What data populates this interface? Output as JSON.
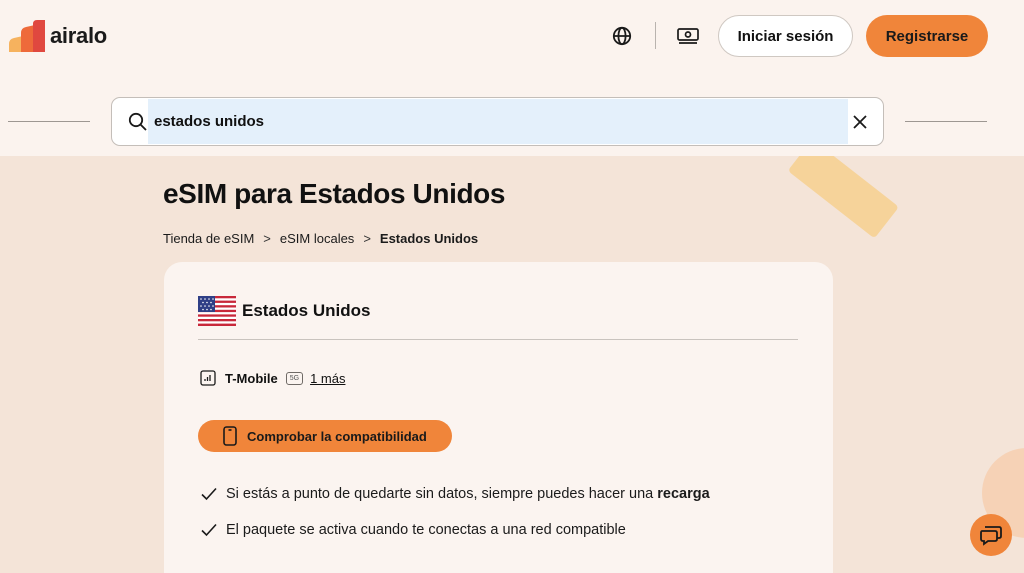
{
  "header": {
    "logo_text": "airalo",
    "login_label": "Iniciar sesión",
    "register_label": "Registrarse",
    "icons": [
      "globe-icon",
      "currency-icon"
    ]
  },
  "search": {
    "value": "estados unidos",
    "icon": "search-icon",
    "clear_icon": "close-icon"
  },
  "main": {
    "title": "eSIM para Estados Unidos",
    "breadcrumb": {
      "items": [
        "Tienda de eSIM",
        "eSIM locales",
        "Estados Unidos"
      ],
      "separator": ">"
    }
  },
  "card": {
    "country": "Estados Unidos",
    "operator": "T-Mobile",
    "network_badge": "5G",
    "more_link": "1 más",
    "compat_button": "Comprobar la compatibilidad",
    "features": [
      {
        "text": "Si estás a punto de quedarte sin datos, siempre puedes hacer una",
        "bold": "recarga"
      },
      {
        "text": "El paquete se activa cuando te conectas a una red compatible"
      }
    ]
  },
  "colors": {
    "accent": "#f0853a",
    "background": "#f4e4d8",
    "header_bg": "#fbf3ee",
    "card_bg": "#fbf4f0",
    "search_highlight": "#e4f0fb"
  }
}
